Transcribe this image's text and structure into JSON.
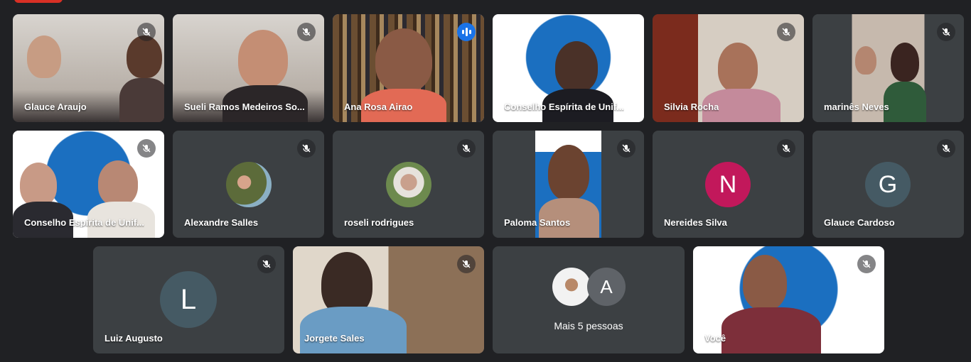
{
  "participants": [
    {
      "name": "Glauce Araujo"
    },
    {
      "name": "Sueli Ramos Medeiros So..."
    },
    {
      "name": "Ana Rosa Airao"
    },
    {
      "name": "Conselho Espírita de Unif..."
    },
    {
      "name": "Silvia Rocha"
    },
    {
      "name": "marinês Neves"
    },
    {
      "name": "Conselho Espírita de Unif..."
    },
    {
      "name": "Alexandre Salles"
    },
    {
      "name": "roseli rodrigues"
    },
    {
      "name": "Paloma Santos"
    },
    {
      "name": "Nereides Silva",
      "initial": "N",
      "color": "#c2185b"
    },
    {
      "name": "Glauce Cardoso",
      "initial": "G",
      "color": "#455a64"
    },
    {
      "name": "Luiz Augusto",
      "initial": "L",
      "color": "#455a64"
    },
    {
      "name": "Jorgete Sales"
    },
    {
      "more_label": "Mais 5 pessoas",
      "initial": "A",
      "color": "#5f6368"
    },
    {
      "name": "Você"
    }
  ],
  "colors": {
    "background": "#202124",
    "tile": "#3c4043",
    "active_border": "#8ab4f8",
    "speaking": "#1a73e8"
  }
}
